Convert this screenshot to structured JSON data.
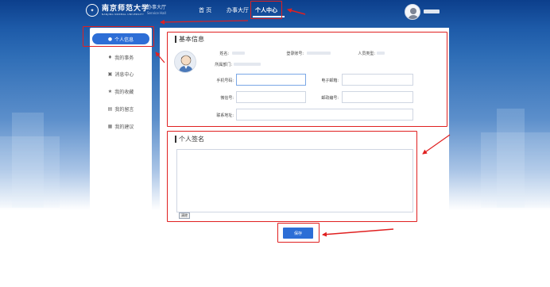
{
  "header": {
    "logo_cn": "南京师范大学",
    "logo_en": "NANJING NORMAL UNIVERSITY",
    "hall_cn": "办事大厅",
    "hall_en": "Service Hall",
    "nav": [
      "首 页",
      "办事大厅",
      "个人中心"
    ]
  },
  "sidebar": {
    "items": [
      {
        "label": "个人信息",
        "icon": "user-icon",
        "active": true
      },
      {
        "label": "我的事务",
        "icon": "pin-icon"
      },
      {
        "label": "消息中心",
        "icon": "message-icon"
      },
      {
        "label": "我的收藏",
        "icon": "star-icon"
      },
      {
        "label": "我的留言",
        "icon": "comment-icon"
      },
      {
        "label": "我的建议",
        "icon": "suggestion-icon"
      }
    ]
  },
  "basic_info": {
    "title": "基本信息",
    "name_label": "姓名:",
    "login_label": "登录账号:",
    "type_label": "人员类型:",
    "dept_label": "所属部门:",
    "phone_label": "手机号码:",
    "email_label": "电子邮箱:",
    "wechat_label": "微信号:",
    "postcode_label": "邮政编号:",
    "address_label": "联系地址:"
  },
  "signature": {
    "title": "个人签名",
    "clear_label": "清除"
  },
  "save_label": "保存",
  "colors": {
    "accent": "#2d6ed6",
    "header_dark": "#0c3f8c",
    "annotation": "#e02020"
  }
}
